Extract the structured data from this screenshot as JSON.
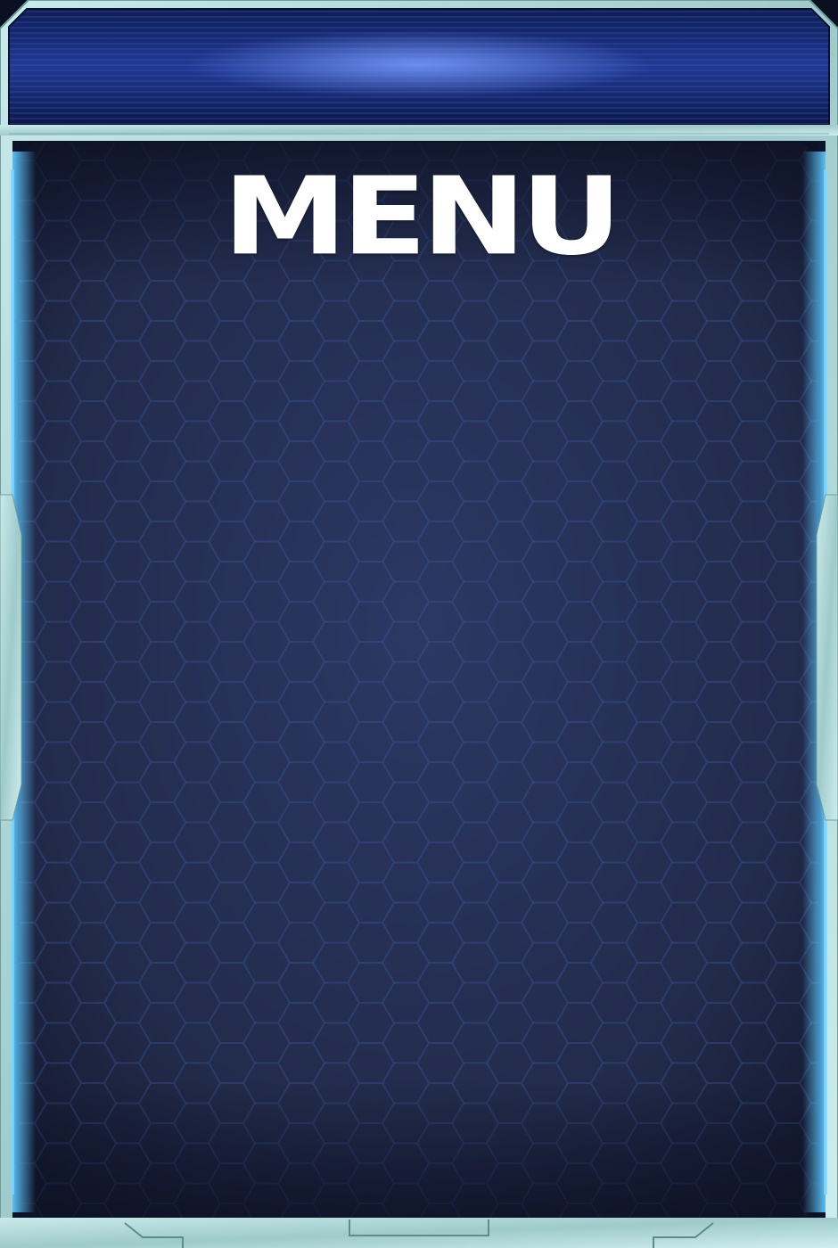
{
  "menu_panel": {
    "title": "MENU"
  },
  "colors": {
    "frame_metal": "#a9d3d3",
    "frame_glow": "#4db4ff",
    "panel_bg": "#232d4e",
    "header_band": "#1a2a6c",
    "title_text": "#ffffff"
  }
}
